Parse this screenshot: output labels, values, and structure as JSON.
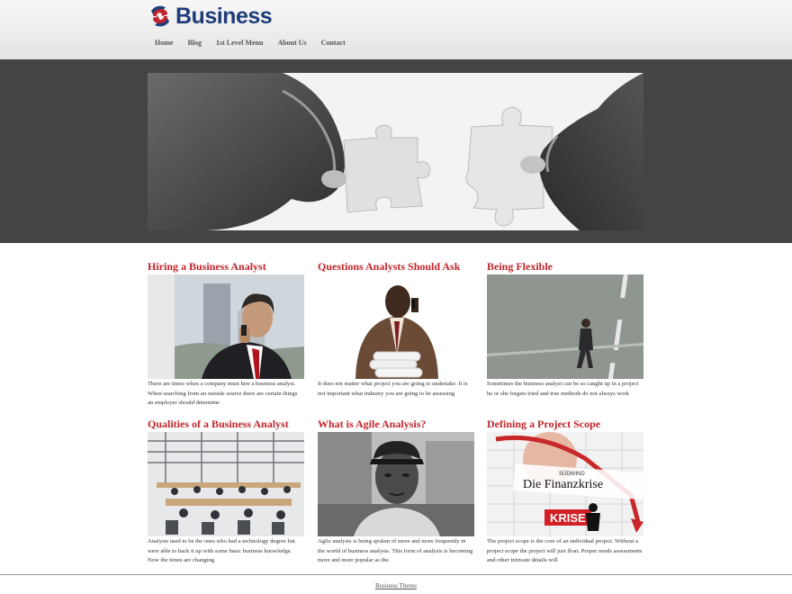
{
  "site": {
    "logo_text": "Business"
  },
  "nav": {
    "items": [
      {
        "label": "Home"
      },
      {
        "label": "Blog"
      },
      {
        "label": "1st Level Menu"
      },
      {
        "label": "About Us"
      },
      {
        "label": "Contact"
      }
    ]
  },
  "articles": [
    {
      "title": "Hiring a Business Analyst",
      "excerpt": "There are times when a company must hire a business analyst. When searching from an outside source there are certain things an employer should determine"
    },
    {
      "title": "Questions Analysts Should Ask",
      "excerpt": "It does not matter what project you are going to undertake. It is not important what industry you are going to be assessing"
    },
    {
      "title": "Being Flexible",
      "excerpt": "Sometimes the business analyst can be so caught up in a project he or she forgets tried and true methods do not always work"
    },
    {
      "title": "Qualities of a Business Analyst",
      "excerpt": "Analysts used to be the ones who had a technology degree but were able to back it up with some basic business knowledge. Now the times are changing."
    },
    {
      "title": "What is Agile Analysis?",
      "excerpt": "Agile analysis is being spoken of more and more frequently in the world of business analysts. This form of analysis is becoming more and more popular as the."
    },
    {
      "title": "Defining a Project Scope",
      "excerpt": "The project scope is the core of an individual project. Without a project scope the project will just float. Proper needs assessments and other intricate details will",
      "image_text": {
        "line1": "SÜDWIND",
        "line2": "Die Finanzkrise",
        "stamp": "KRISE"
      }
    }
  ],
  "footer": {
    "link": "Business Theme"
  },
  "colors": {
    "title": "#c0252b",
    "logo": "#1d3c78",
    "hero_bg": "#444444"
  }
}
